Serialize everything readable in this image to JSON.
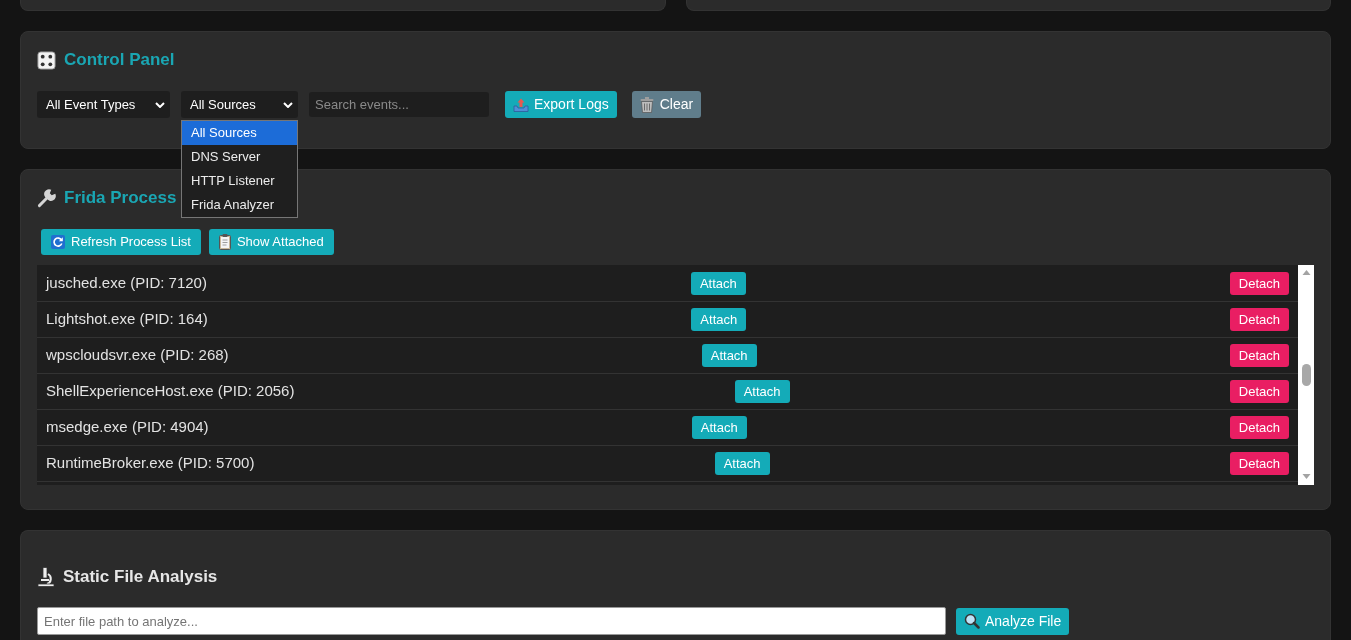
{
  "control_panel": {
    "title": "Control Panel",
    "event_type_filter": {
      "value": "All Event Types"
    },
    "source_filter": {
      "value": "All Sources",
      "expanded": true,
      "options": [
        {
          "label": "All Sources",
          "selected": true
        },
        {
          "label": "DNS Server",
          "selected": false
        },
        {
          "label": "HTTP Listener",
          "selected": false
        },
        {
          "label": "Frida Analyzer",
          "selected": false
        }
      ]
    },
    "search": {
      "placeholder": "Search events..."
    },
    "buttons": [
      {
        "kind": "export",
        "label": "Export Logs"
      },
      {
        "kind": "clear",
        "label": "Clear"
      }
    ]
  },
  "frida_panel": {
    "title": "Frida Process",
    "buttons": [
      {
        "kind": "refresh",
        "label": "Refresh Process List"
      },
      {
        "kind": "attached",
        "label": "Show Attached"
      }
    ],
    "processes": [
      {
        "name": "jusched.exe (PID: 7120)",
        "attach": "Attach",
        "detach": "Detach"
      },
      {
        "name": "Lightshot.exe (PID: 164)",
        "attach": "Attach",
        "detach": "Detach"
      },
      {
        "name": "wpscloudsvr.exe (PID: 268)",
        "attach": "Attach",
        "detach": "Detach"
      },
      {
        "name": "ShellExperienceHost.exe (PID: 2056)",
        "attach": "Attach",
        "detach": "Detach"
      },
      {
        "name": "msedge.exe (PID: 4904)",
        "attach": "Attach",
        "detach": "Detach"
      },
      {
        "name": "RuntimeBroker.exe (PID: 5700)",
        "attach": "Attach",
        "detach": "Detach"
      }
    ]
  },
  "static_analysis": {
    "title": "Static File Analysis",
    "file_path": {
      "placeholder": "Enter file path to analyze..."
    },
    "analyze_button": {
      "label": "Analyze File"
    }
  }
}
